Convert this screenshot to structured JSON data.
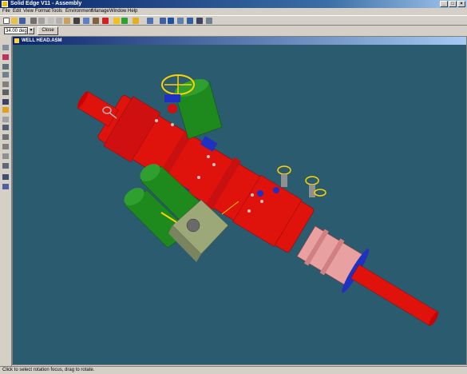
{
  "window": {
    "title": "Solid Edge V11 - Assembly"
  },
  "menu": [
    "File",
    "Edit",
    "View",
    "Format",
    "Tools",
    "Environment",
    "Manage",
    "Window",
    "Help"
  ],
  "toolbar": {
    "step_value": "34.00 deg",
    "close_label": "Close"
  },
  "document": {
    "title": "WELL HEAD.ASM"
  },
  "status": {
    "text": "Click to select rotation focus, drag to rotate."
  },
  "colors": {
    "viewport_bg": "#2b5b6f",
    "body_red": "#e0120c",
    "green": "#1e8a1e",
    "pink": "#e8a0a0",
    "blue": "#2030c0",
    "yellow": "#ffd200"
  }
}
